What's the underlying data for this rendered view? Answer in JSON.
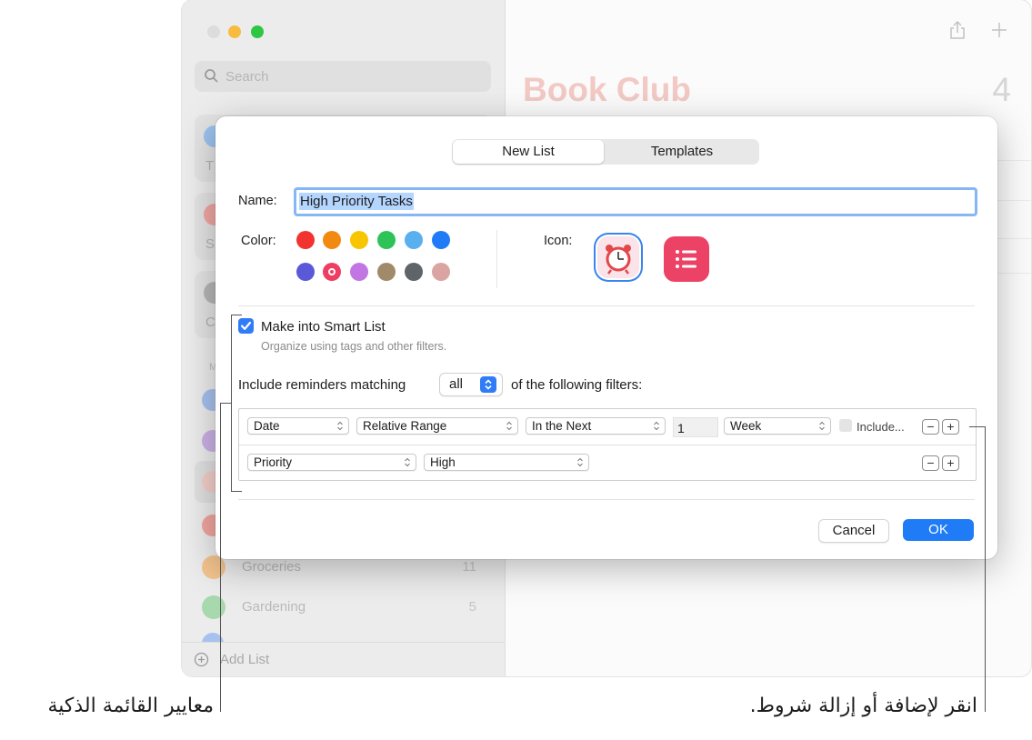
{
  "background_window": {
    "search_placeholder": "Search",
    "list_title": "Book Club",
    "list_count": "4",
    "lists": [
      {
        "name": "Groceries",
        "count": "11",
        "color": "#f3c48e"
      },
      {
        "name": "Gardening",
        "count": "5",
        "color": "#a7d8ae"
      }
    ],
    "add_list_label": "Add List",
    "card_letters": [
      "T",
      "S",
      "C"
    ],
    "section_letter": "M"
  },
  "dialog": {
    "tabs": [
      "New List",
      "Templates"
    ],
    "name_label": "Name:",
    "name_value": "High Priority Tasks",
    "color_label": "Color:",
    "colors_row1": [
      "#f3332f",
      "#f28a12",
      "#f8c600",
      "#2ec357",
      "#5aafef",
      "#1f7cf6"
    ],
    "colors_row2": [
      "#5a5ad8",
      "#ee3e62",
      "#c176e3",
      "#a08a6a",
      "#5f6468",
      "#d9a4a1"
    ],
    "icon_label": "Icon:",
    "smart_list_label": "Make into Smart List",
    "smart_list_hint": "Organize using tags and other filters.",
    "include_prefix": "Include reminders matching",
    "match_value": "all",
    "include_suffix": "of the following filters:",
    "filter1": {
      "field": "Date",
      "range": "Relative Range",
      "when": "In the Next",
      "number": "1",
      "unit": "Week",
      "include_label": "Include..."
    },
    "filter2": {
      "field": "Priority",
      "value": "High"
    },
    "minus": "−",
    "plus": "+",
    "cancel_label": "Cancel",
    "ok_label": "OK",
    "accent": "#1f7cf6"
  },
  "callouts": {
    "left": "معايير القائمة الذكية",
    "right": "انقر لإضافة أو إزالة شروط."
  }
}
